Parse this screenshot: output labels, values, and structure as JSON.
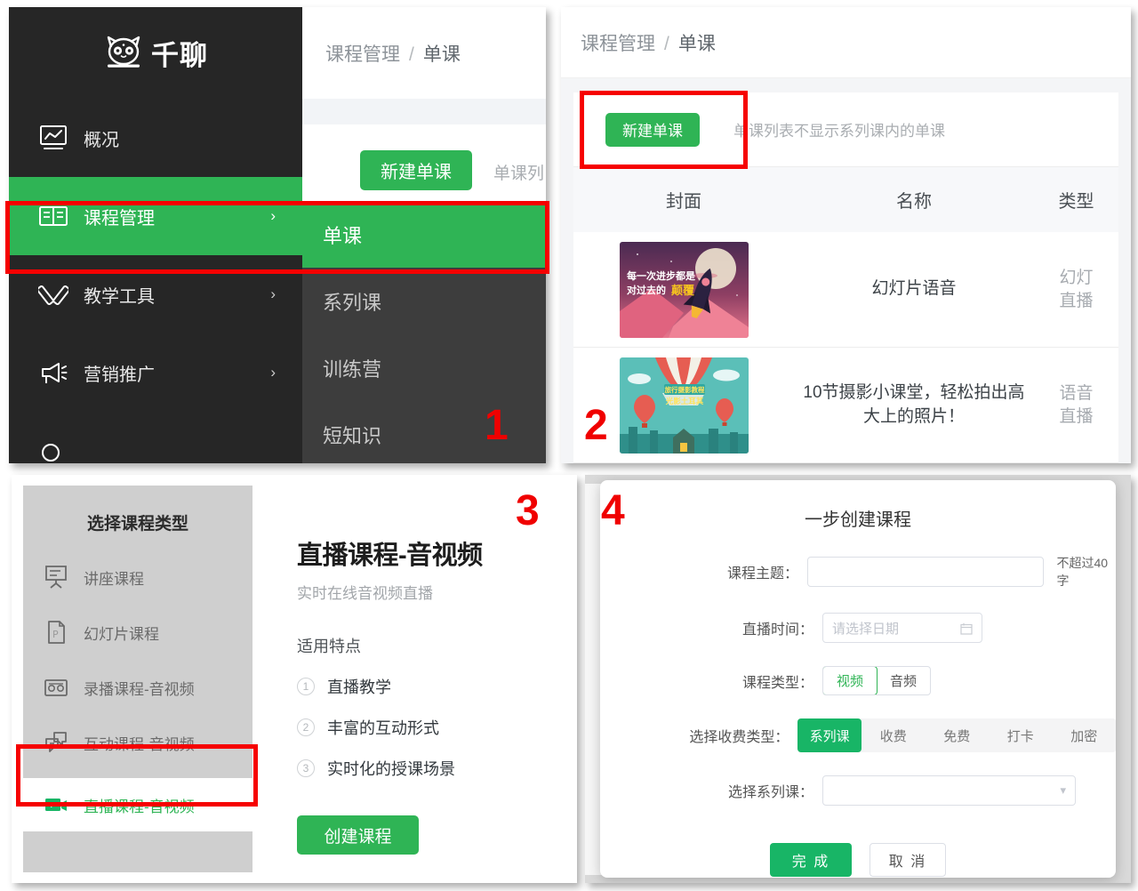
{
  "brand": {
    "name": "千聊",
    "logo_icon": "cat-mascot-icon",
    "accent": "#2fb455"
  },
  "panel1": {
    "step": "1",
    "breadcrumb": {
      "parent": "课程管理",
      "separator": "/",
      "current": "单课"
    },
    "sidebar": {
      "items": [
        {
          "label": "概况",
          "icon": "chart-monitor-icon",
          "chevron": "",
          "active": false
        },
        {
          "label": "课程管理",
          "icon": "open-book-icon",
          "chevron": "›",
          "active": true
        },
        {
          "label": "教学工具",
          "icon": "crossed-tools-icon",
          "chevron": "›",
          "active": false
        },
        {
          "label": "营销推广",
          "icon": "megaphone-icon",
          "chevron": "›",
          "active": false
        }
      ]
    },
    "submenu": {
      "items": [
        {
          "label": "单课",
          "active": true
        },
        {
          "label": "系列课",
          "active": false
        },
        {
          "label": "训练营",
          "active": false
        },
        {
          "label": "短知识",
          "active": false
        }
      ]
    },
    "toolbar": {
      "new_button": "新建单课",
      "hint": "单课列"
    }
  },
  "panel2": {
    "step": "2",
    "breadcrumb": {
      "parent": "课程管理",
      "separator": "/",
      "current": "单课"
    },
    "toolbar": {
      "new_button": "新建单课",
      "hint": "单课列表不显示系列课内的单课"
    },
    "table": {
      "columns": [
        "封面",
        "名称",
        "类型"
      ],
      "rows": [
        {
          "cover": "rocket-mountain-thumbnail",
          "cover_text_1": "每一次进步都是",
          "cover_text_2": "对过去的",
          "cover_text_3": "颠覆",
          "name": "幻灯片语音",
          "type_line1": "幻灯",
          "type_line2": "直播"
        },
        {
          "cover": "hot-air-balloon-thumbnail",
          "cover_text_1": "旅行摄影教程",
          "cover_text_2": "光影土耳其",
          "name": "10节摄影小课堂，轻松拍出高大上的照片！",
          "type_line1": "语音",
          "type_line2": "直播"
        }
      ]
    }
  },
  "panel3": {
    "step": "3",
    "title": "选择课程类型",
    "course_types": [
      {
        "label": "讲座课程",
        "icon": "presentation-board-icon",
        "selected": false
      },
      {
        "label": "幻灯片课程",
        "icon": "ppt-file-icon",
        "selected": false
      },
      {
        "label": "录播课程-音视频",
        "icon": "cassette-tape-icon",
        "selected": false
      },
      {
        "label": "互动课程-音视频",
        "icon": "chat-bubbles-icon",
        "selected": false
      },
      {
        "label": "直播课程-音视频",
        "icon": "video-camera-icon",
        "selected": true
      }
    ],
    "detail": {
      "heading": "直播课程-音视频",
      "subheading": "实时在线音视频直播",
      "features_title": "适用特点",
      "features": [
        {
          "num": "1",
          "text": "直播教学"
        },
        {
          "num": "2",
          "text": "丰富的互动形式"
        },
        {
          "num": "3",
          "text": "实时化的授课场景"
        }
      ],
      "create_button": "创建课程"
    }
  },
  "panel4": {
    "step": "4",
    "dialog_title": "一步创建课程",
    "fields": {
      "topic": {
        "label": "课程主题：",
        "value": "",
        "placeholder": "",
        "note": "不超过40字"
      },
      "live_time": {
        "label": "直播时间：",
        "value": "",
        "placeholder": "请选择日期",
        "icon": "calendar-icon"
      },
      "course_type": {
        "label": "课程类型：",
        "options": [
          "视频",
          "音频"
        ],
        "selected": "视频"
      },
      "charge_type": {
        "label": "选择收费类型：",
        "options": [
          "系列课",
          "收费",
          "免费",
          "打卡",
          "加密"
        ],
        "selected": "系列课"
      },
      "series": {
        "label": "选择系列课：",
        "value": "",
        "placeholder": "",
        "icon": "chevron-down-icon"
      }
    },
    "actions": {
      "confirm": "完 成",
      "cancel": "取 消"
    }
  }
}
